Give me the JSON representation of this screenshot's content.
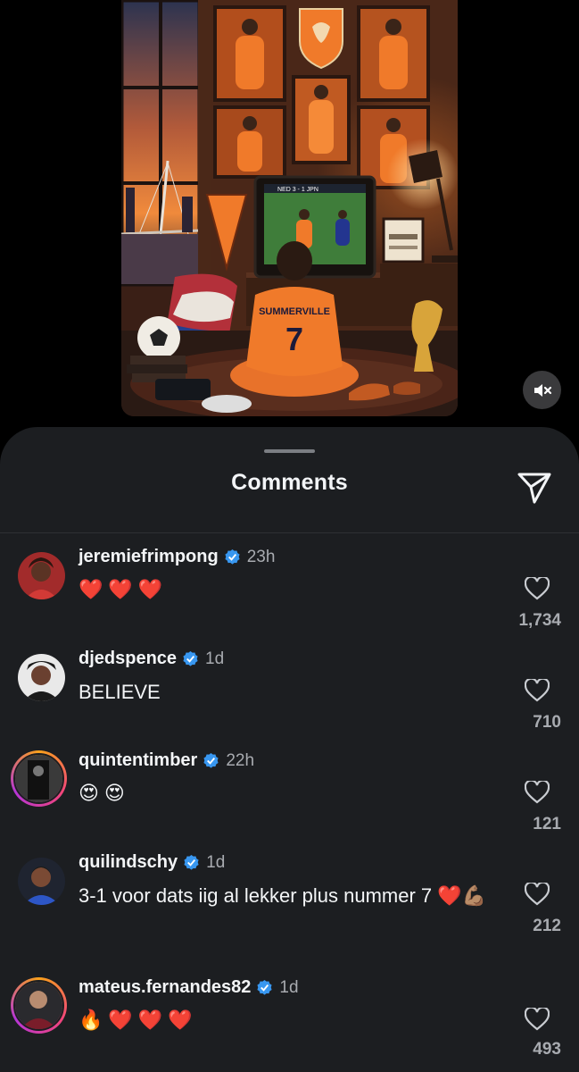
{
  "sheet": {
    "title": "Comments",
    "share_icon": "paper-plane-icon",
    "mute_icon": "speaker-muted-icon"
  },
  "post_image": {
    "jersey_name": "SUMMERVILLE",
    "jersey_number": "7",
    "tv_score": "NED 3 - 1 JPN"
  },
  "comments": [
    {
      "username": "jeremiefrimpong",
      "time": "23h",
      "text": "❤️❤️❤️",
      "likes": "1,734",
      "verified": true
    },
    {
      "username": "djedspence",
      "time": "1d",
      "text": "BELIEVE",
      "likes": "710",
      "verified": true
    },
    {
      "username": "quintentimber",
      "time": "22h",
      "text": "😍😍",
      "likes": "121",
      "verified": true
    },
    {
      "username": "quilindschy",
      "time": "1d",
      "text": "3-1 voor dats iig al lekker plus nummer 7 ❤️💪🏽",
      "likes": "212",
      "verified": true
    },
    {
      "username": "mateus.fernandes82",
      "time": "1d",
      "text": "🔥❤️❤️❤️",
      "likes": "493",
      "verified": true
    }
  ],
  "colors": {
    "sheet_bg": "#1c1e21",
    "verified": "#3897f0",
    "heart": "#e3203b"
  }
}
